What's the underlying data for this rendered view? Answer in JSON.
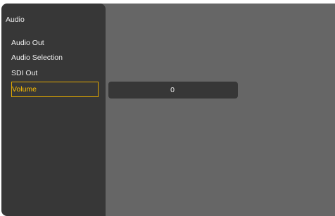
{
  "sidebar": {
    "title": "Audio",
    "items": [
      {
        "label": "Audio Out",
        "selected": false
      },
      {
        "label": "Audio Selection",
        "selected": false
      },
      {
        "label": "SDI Out",
        "selected": false
      },
      {
        "label": "Volume",
        "selected": true
      }
    ]
  },
  "main": {
    "volume_value": "0"
  },
  "colors": {
    "sidebar_bg": "#373737",
    "content_bg": "#666666",
    "highlight": "#ffc000",
    "text": "#f0f0f0"
  }
}
